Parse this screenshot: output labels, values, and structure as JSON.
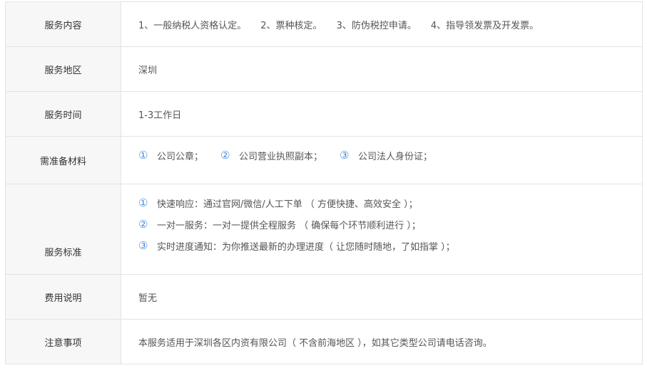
{
  "rows": [
    {
      "label": "服务内容",
      "items": [
        "1、一般纳税人资格认定。",
        "2、票种核定。",
        "3、防伪税控申请。",
        "4、指导领发票及开发票。"
      ]
    },
    {
      "label": "服务地区",
      "text": "深圳"
    },
    {
      "label": "服务时间",
      "text": "1-3工作日"
    },
    {
      "label": "需准备材料",
      "items": [
        {
          "num": "①",
          "text": "公司公章；"
        },
        {
          "num": "②",
          "text": "公司营业执照副本；"
        },
        {
          "num": "③",
          "text": "公司法人身份证；"
        }
      ]
    },
    {
      "label": "服务标准",
      "items": [
        {
          "num": "①",
          "text": "快速响应：通过官网/微信/人工下单 （ 方便快捷、高效安全 ）；"
        },
        {
          "num": "②",
          "text": "一对一服务：一对一提供全程服务 （ 确保每个环节顺利进行 ）；"
        },
        {
          "num": "③",
          "text": "实时进度通知：为你推送最新的办理进度（ 让您随时随地，了如指掌 ）；"
        }
      ]
    },
    {
      "label": "费用说明",
      "text": "暂无"
    },
    {
      "label": "注意事项",
      "text": "本服务适用于深圳各区内资有限公司（ 不含前海地区 ），如其它类型公司请电话咨询。"
    }
  ]
}
